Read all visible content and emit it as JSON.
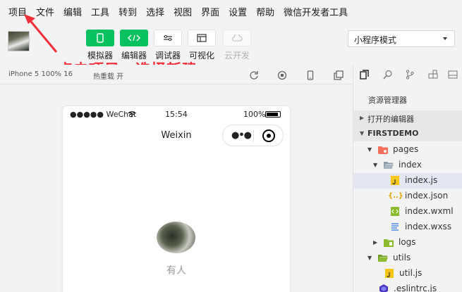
{
  "menubar": {
    "items": [
      "项目",
      "文件",
      "编辑",
      "工具",
      "转到",
      "选择",
      "视图",
      "界面",
      "设置",
      "帮助",
      "微信开发者工具"
    ]
  },
  "toolbar": {
    "buttons": [
      {
        "label": "模拟器",
        "icon": "phone-icon"
      },
      {
        "label": "编辑器",
        "icon": "code-icon"
      },
      {
        "label": "调试器",
        "icon": "debug-icon"
      },
      {
        "label": "可视化",
        "icon": "layout-icon"
      },
      {
        "label": "云开发",
        "icon": "cloud-icon"
      }
    ],
    "mode_select": "小程序模式"
  },
  "annotation": "点击项目，选择新建",
  "simbar": {
    "device": "iPhone 5 100% 16",
    "compile": "热重载 开"
  },
  "phone": {
    "signal": "●●●●● WeChat",
    "time": "15:54",
    "battery_pct": "100%",
    "nav_title": "Weixin",
    "capsule_dots": "●•●",
    "user_name": "有人"
  },
  "explorer": {
    "title": "资源管理器",
    "open_editors": "打开的编辑器",
    "project": "FIRSTDEMO",
    "tree": [
      {
        "label": "pages",
        "type": "folder",
        "color": "#f26e5b",
        "open": true
      },
      {
        "label": "index",
        "type": "folder",
        "color": "#8a9aa8",
        "open": true
      },
      {
        "label": "index.js",
        "type": "js",
        "selected": true
      },
      {
        "label": "index.json",
        "type": "json"
      },
      {
        "label": "index.wxml",
        "type": "wxml"
      },
      {
        "label": "index.wxss",
        "type": "wxss"
      },
      {
        "label": "logs",
        "type": "folder",
        "color": "#8dbb2f",
        "open": false
      },
      {
        "label": "utils",
        "type": "folder",
        "color": "#8dbb2f",
        "open": true
      },
      {
        "label": "util.js",
        "type": "js"
      },
      {
        "label": ".eslintrc.js",
        "type": "eslint"
      }
    ]
  },
  "colors": {
    "accent_green": "#07c160",
    "annotation_red": "#f0303a",
    "selection": "#e4e6f1"
  }
}
